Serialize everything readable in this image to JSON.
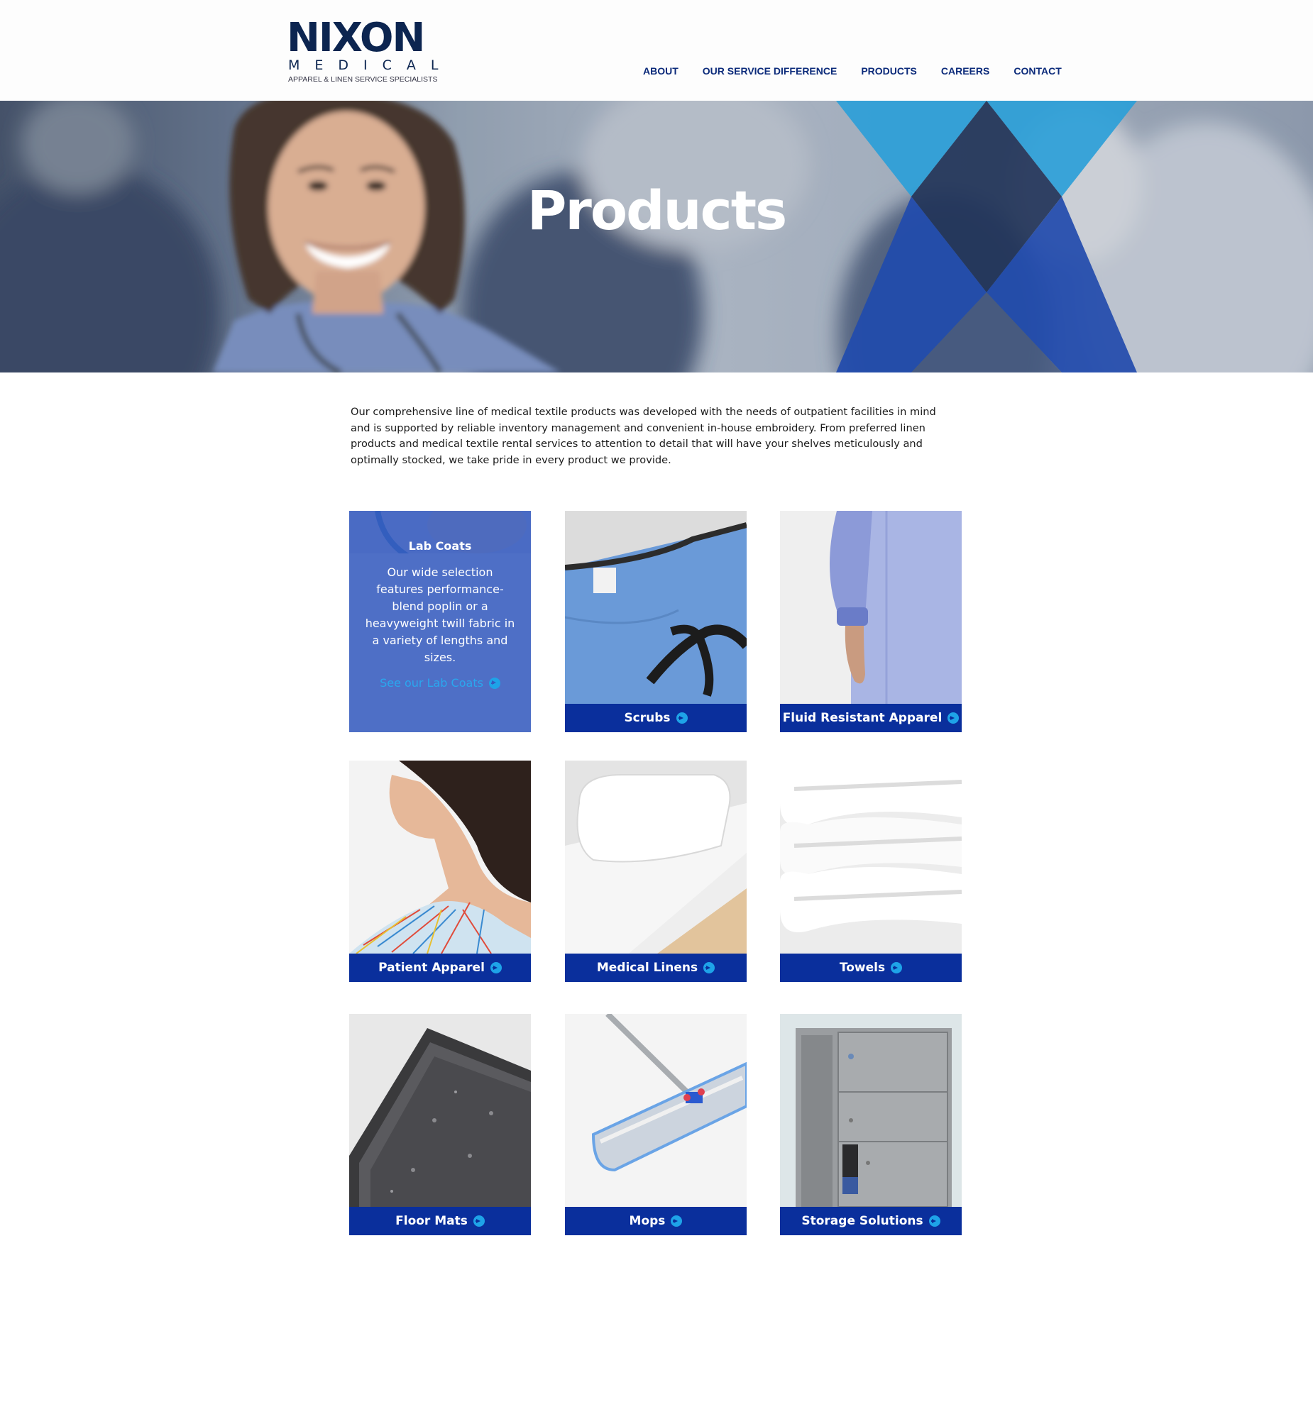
{
  "header": {
    "logo": {
      "word": "NIXON",
      "sub": "MEDICAL",
      "tagline": "APPAREL & LINEN SERVICE SPECIALISTS"
    },
    "nav": [
      "ABOUT",
      "OUR SERVICE DIFFERENCE",
      "PRODUCTS",
      "CAREERS",
      "CONTACT"
    ]
  },
  "hero": {
    "title": "Products"
  },
  "intro": "Our comprehensive line of medical textile products was developed with the needs of outpatient facilities in mind and is supported by reliable inventory management and convenient in-house embroidery. From preferred linen products and medical textile rental services to attention to detail that will have your shelves meticulously and optimally stocked, we take pride in every product we provide.",
  "products": [
    {
      "label": "Lab Coats",
      "description": "Our wide selection features performance-blend poplin or a heavyweight twill fabric in a variety of lengths and sizes.",
      "link": "See our Lab Coats",
      "icon": "arrow-circle-icon"
    },
    {
      "label": "Scrubs",
      "icon": "arrow-circle-icon"
    },
    {
      "label": "Fluid Resistant Apparel",
      "icon": "arrow-circle-icon"
    },
    {
      "label": "Patient Apparel",
      "icon": "arrow-circle-icon"
    },
    {
      "label": "Medical Linens",
      "icon": "arrow-circle-icon"
    },
    {
      "label": "Towels",
      "icon": "arrow-circle-icon"
    },
    {
      "label": "Floor Mats",
      "icon": "arrow-circle-icon"
    },
    {
      "label": "Mops",
      "icon": "arrow-circle-icon"
    },
    {
      "label": "Storage Solutions",
      "icon": "arrow-circle-icon"
    }
  ],
  "colors": {
    "brand_navy": "#0c2550",
    "nav_blue": "#0b2a7a",
    "bar_blue": "#0a2f9c",
    "accent_cyan": "#1ea3e8",
    "hero_bright_blue": "#1f9ad6",
    "hero_royal_blue": "#1340a8"
  }
}
